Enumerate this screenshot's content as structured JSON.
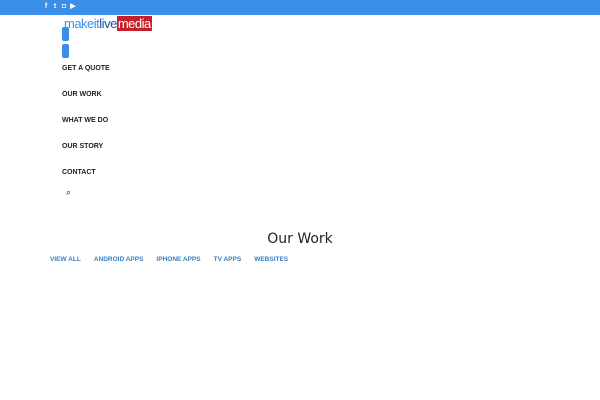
{
  "topbar": {
    "social": [
      {
        "icon": "facebook-icon",
        "glyph": "f"
      },
      {
        "icon": "twitter-icon",
        "glyph": "t"
      },
      {
        "icon": "instagram-icon",
        "glyph": "◘"
      },
      {
        "icon": "youtube-icon",
        "glyph": "▶"
      }
    ]
  },
  "logo": {
    "part1": "makeit",
    "part2": "live",
    "part3": "media"
  },
  "nav": [
    "GET A QUOTE",
    "OUR WORK",
    "WHAT WE DO",
    "OUR STORY",
    "CONTACT"
  ],
  "search_glyph": "⌕",
  "page_title": "Our Work",
  "filters": [
    "VIEW ALL",
    "ANDROID APPS",
    "IPHONE APPS",
    "TV APPS",
    "WEBSITES"
  ],
  "colors": {
    "accent": "#3b8ee8",
    "filter": "#3b7cc4",
    "logo_red": "#c8202b"
  }
}
